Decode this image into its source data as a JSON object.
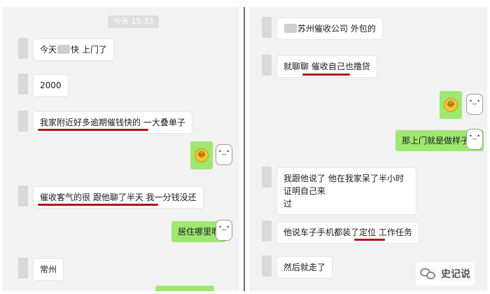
{
  "left_chat": {
    "time": "今天 15:33",
    "messages": [
      {
        "dir": "in",
        "before": "今天",
        "after": "快 上门了"
      },
      {
        "dir": "in",
        "text": "2000"
      },
      {
        "dir": "in",
        "text": "我家附近好多逾期催钱快的 一大叠单子"
      },
      {
        "dir": "out",
        "emoji": "laughing-face"
      },
      {
        "dir": "in",
        "text": "催收客气的很 跟他聊了半天 我一分钱没还"
      },
      {
        "dir": "out",
        "text": "居住哪里啊"
      },
      {
        "dir": "in",
        "text": "常州"
      }
    ]
  },
  "right_chat": {
    "messages": [
      {
        "dir": "in",
        "text": "苏州催收公司 外包的"
      },
      {
        "dir": "in",
        "text": "就聊聊 催收自己也撸贷"
      },
      {
        "dir": "out",
        "emoji": "laughing-face"
      },
      {
        "dir": "out",
        "text": "那上门就是做样子咯"
      },
      {
        "dir": "in",
        "line1": "我跟他说了 他在我家呆了半小时 证明自己来",
        "line2": "过"
      },
      {
        "dir": "in",
        "text": "他说车子手机都装了定位 工作任务"
      },
      {
        "dir": "in",
        "text": "然后就走了"
      }
    ]
  },
  "watermark": {
    "label": "史记说",
    "icon": "wechat-icon"
  },
  "colors": {
    "outgoing_bubble": "#9ee870",
    "incoming_bubble": "#ffffff",
    "underline": "#b0141c"
  }
}
